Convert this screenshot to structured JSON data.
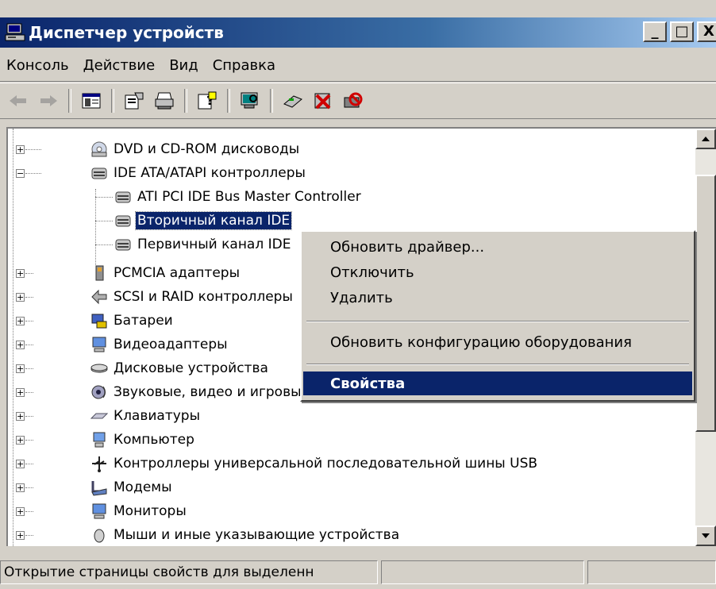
{
  "window": {
    "title": "Диспетчер устройств",
    "controls": {
      "minimize": "_",
      "maximize": "□",
      "close": "X"
    }
  },
  "menubar": [
    "Консоль",
    "Действие",
    "Вид",
    "Справка"
  ],
  "toolbar": {
    "buttons": [
      {
        "icon": "back-arrow-icon",
        "enabled": false
      },
      {
        "icon": "forward-arrow-icon",
        "enabled": false
      },
      {
        "icon": "show-hide-console-tree-icon",
        "enabled": true
      },
      {
        "icon": "properties-icon",
        "enabled": true
      },
      {
        "icon": "print-icon",
        "enabled": true
      },
      {
        "icon": "help-icon",
        "enabled": true
      },
      {
        "icon": "scan-hardware-icon",
        "enabled": true
      },
      {
        "icon": "update-driver-icon",
        "enabled": true
      },
      {
        "icon": "uninstall-icon",
        "enabled": true
      },
      {
        "icon": "disable-icon",
        "enabled": true
      }
    ]
  },
  "tree": {
    "rows": [
      {
        "label": "DVD и CD-ROM дисководы",
        "expander": "+",
        "icon": "dvd-drive-icon"
      },
      {
        "label": "IDE ATA/ATAPI контроллеры",
        "expander": "-",
        "icon": "ide-controller-icon"
      },
      {
        "label": "ATI PCI IDE Bus Master Controller",
        "icon": "ide-controller-icon"
      },
      {
        "label": "Вторичный канал IDE",
        "icon": "ide-controller-icon",
        "selected": true
      },
      {
        "label": "Первичный канал IDE",
        "icon": "ide-controller-icon"
      },
      {
        "label": "PCMCIA адаптеры",
        "expander": "+",
        "icon": "pcmcia-icon"
      },
      {
        "label": "SCSI и RAID контроллеры",
        "expander": "+",
        "icon": "scsi-icon"
      },
      {
        "label": "Батареи",
        "expander": "+",
        "icon": "battery-icon"
      },
      {
        "label": "Видеоадаптеры",
        "expander": "+",
        "icon": "display-adapter-icon"
      },
      {
        "label": "Дисковые устройства",
        "expander": "+",
        "icon": "disk-drive-icon"
      },
      {
        "label": "Звуковые, видео и игровые устройства",
        "expander": "+",
        "icon": "sound-icon"
      },
      {
        "label": "Клавиатуры",
        "expander": "+",
        "icon": "keyboard-icon"
      },
      {
        "label": "Компьютер",
        "expander": "+",
        "icon": "computer-icon"
      },
      {
        "label": "Контроллеры универсальной последовательной шины USB",
        "expander": "+",
        "icon": "usb-icon"
      },
      {
        "label": "Модемы",
        "expander": "+",
        "icon": "modem-icon"
      },
      {
        "label": "Мониторы",
        "expander": "+",
        "icon": "monitor-icon"
      },
      {
        "label": "Мыши и иные указывающие устройства",
        "expander": "+",
        "icon": "mouse-icon"
      }
    ]
  },
  "context_menu": {
    "items": [
      {
        "label": "Обновить драйвер..."
      },
      {
        "label": "Отключить"
      },
      {
        "label": "Удалить"
      },
      {
        "label": "Обновить конфигурацию оборудования"
      },
      {
        "label": "Свойства",
        "highlighted": true
      }
    ]
  },
  "statusbar": {
    "text": "Открытие страницы свойств для выделенн",
    "pane2": "",
    "pane3": ""
  },
  "colors": {
    "title_active": "#0a246a",
    "selection": "#0a246a",
    "face": "#d4d0c8"
  }
}
